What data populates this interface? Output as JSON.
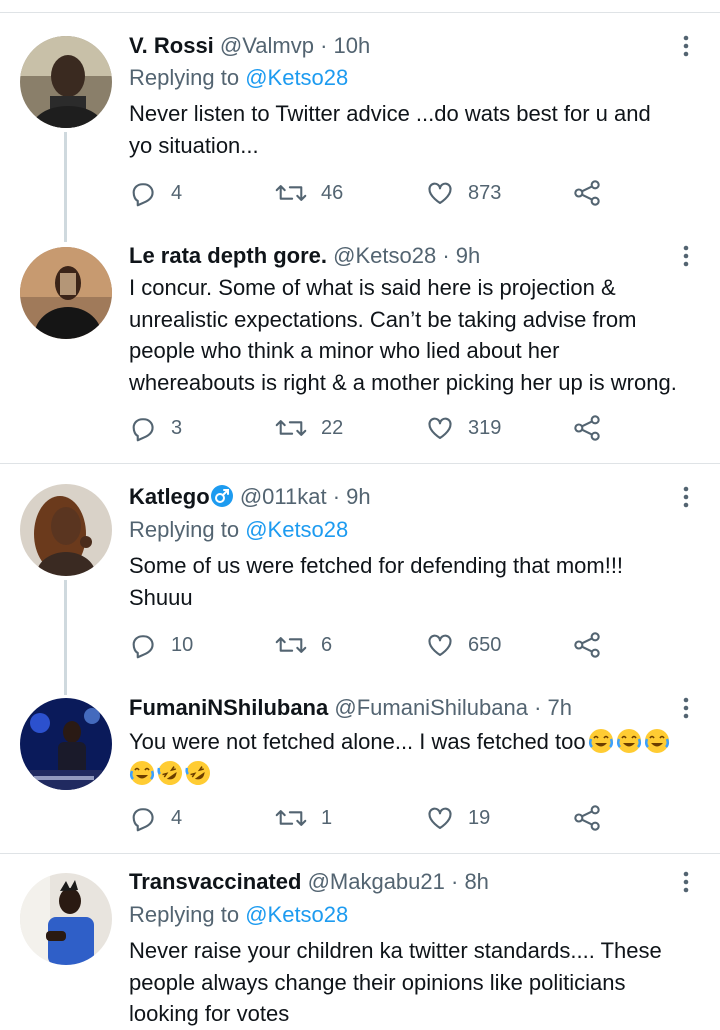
{
  "tweets": [
    {
      "name": "V. Rossi",
      "handle": "@Valmvp",
      "time": "· 10h",
      "replying_prefix": "Replying to",
      "replying_to": "@Ketso28",
      "text_lines": [
        "Never listen to Twitter advice ...do wats best for u and",
        "yo situation..."
      ],
      "replies": "4",
      "retweets": "46",
      "likes": "873"
    },
    {
      "name": "Le rata depth gore.",
      "handle": "@Ketso28",
      "time": "· 9h",
      "text_lines": [
        "I concur. Some of what is said here is projection &",
        "unrealistic expectations. Can’t be taking advise from",
        "people who think a minor who lied about her",
        "whereabouts is right & a mother picking her up is wrong."
      ],
      "replies": "3",
      "retweets": "22",
      "likes": "319"
    },
    {
      "name": "Katlego",
      "handle": "@011kat",
      "time": "· 9h",
      "replying_prefix": "Replying to",
      "replying_to": "@Ketso28",
      "text_lines": [
        "Some of us were fetched for defending that mom!!!",
        "Shuuu"
      ],
      "replies": "10",
      "retweets": "6",
      "likes": "650"
    },
    {
      "name": "FumaniNShilubana",
      "handle": "@FumaniShilubana",
      "time": "· 7h",
      "text_line1": "You were not fetched alone... I was fetched too",
      "emoji_line1": [
        "face-with-tears-of-joy",
        "face-with-tears-of-joy",
        "face-with-tears-of-joy"
      ],
      "emoji_line2": [
        "face-with-tears-of-joy",
        "rolling-on-floor-laughing",
        "rolling-on-floor-laughing"
      ],
      "replies": "4",
      "retweets": "1",
      "likes": "19"
    },
    {
      "name": "Transvaccinated",
      "handle": "@Makgabu21",
      "time": "· 8h",
      "replying_prefix": "Replying to",
      "replying_to": "@Ketso28",
      "text_lines": [
        "Never raise your children ka twitter standards.... These",
        "people always change their opinions like politicians",
        "looking for votes"
      ]
    }
  ],
  "colors": {
    "mention": "#1d9bf0",
    "muted": "#536471",
    "text": "#0f1419",
    "divider": "#dfe3e6"
  },
  "icons": [
    "reply-icon",
    "retweet-icon",
    "like-icon",
    "share-icon",
    "more-options-icon",
    "verified-badge-icon"
  ]
}
